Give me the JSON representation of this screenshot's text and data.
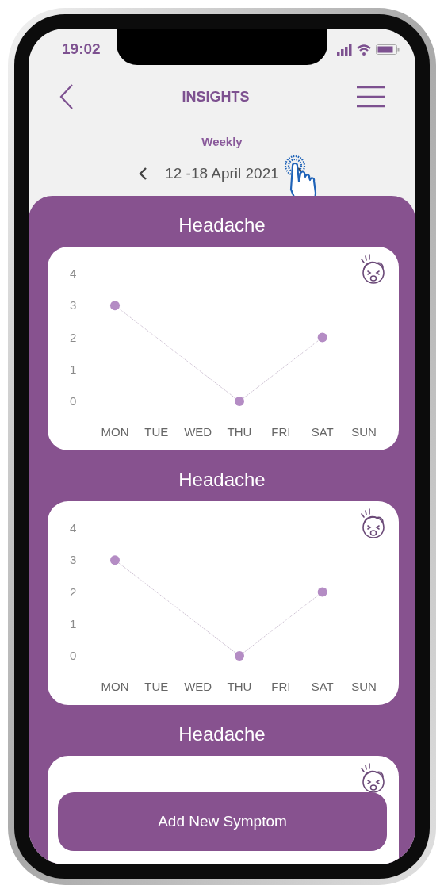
{
  "status_bar": {
    "time": "19:02"
  },
  "header": {
    "title": "INSIGHTS"
  },
  "period": {
    "label": "Weekly",
    "range": "12 -18 April 2021"
  },
  "symptoms": [
    {
      "title": "Headache",
      "chart_data": {
        "type": "line",
        "categories": [
          "MON",
          "TUE",
          "WED",
          "THU",
          "FRI",
          "SAT",
          "SUN"
        ],
        "series": [
          {
            "color": "#b48cc4",
            "line_style": "dotted",
            "marker": "circle",
            "values": [
              3,
              null,
              null,
              0,
              null,
              2,
              null
            ]
          }
        ],
        "ylim": [
          0,
          4
        ],
        "yticks": [
          0,
          1,
          2,
          3,
          4
        ]
      }
    },
    {
      "title": "Headache",
      "chart_data": {
        "type": "line",
        "categories": [
          "MON",
          "TUE",
          "WED",
          "THU",
          "FRI",
          "SAT",
          "SUN"
        ],
        "series": [
          {
            "color": "#b48cc4",
            "line_style": "dotted",
            "marker": "circle",
            "values": [
              3,
              null,
              null,
              0,
              null,
              2,
              null
            ]
          }
        ],
        "ylim": [
          0,
          4
        ],
        "yticks": [
          0,
          1,
          2,
          3,
          4
        ]
      }
    },
    {
      "title": "Headache"
    }
  ],
  "add_button": {
    "label": "Add New Symptom"
  }
}
